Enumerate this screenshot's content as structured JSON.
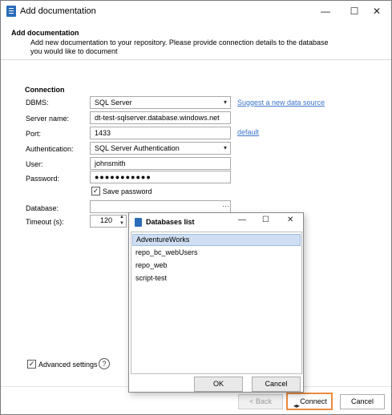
{
  "window": {
    "title": "Add documentation",
    "minimize": "—",
    "maximize": "☐",
    "close": "✕"
  },
  "header": {
    "title": "Add documentation",
    "description": "Add new documentation to your repository. Please provide connection details to the database you would like to document"
  },
  "connection": {
    "section_title": "Connection",
    "dbms_label": "DBMS:",
    "dbms_value": "SQL Server",
    "suggest_link": "Suggest a new data source",
    "server_label": "Server name:",
    "server_value": "dt-test-sqlserver.database.windows.net",
    "port_label": "Port:",
    "port_value": "1433",
    "default_link": "default",
    "auth_label": "Authentication:",
    "auth_value": "SQL Server Authentication",
    "user_label": "User:",
    "user_value": "johnsmith",
    "password_label": "Password:",
    "password_value": "●●●●●●●●●●●",
    "save_password_label": "Save password",
    "save_password_checked": true,
    "database_label": "Database:",
    "database_value": "",
    "database_browse": "···",
    "timeout_label": "Timeout (s):",
    "timeout_value": "120"
  },
  "advanced": {
    "label": "Advanced settings",
    "checked": true,
    "help": "?"
  },
  "footer": {
    "back_label": "< Back",
    "connect_label": "Connect",
    "cancel_label": "Cancel"
  },
  "databases_dialog": {
    "title": "Databases list",
    "minimize": "—",
    "maximize": "☐",
    "close": "✕",
    "items": [
      "AdventureWorks",
      "repo_bc_webUsers",
      "repo_web",
      "script-test"
    ],
    "selected_index": 0,
    "ok_label": "OK",
    "cancel_label": "Cancel"
  },
  "colors": {
    "accent": "#2b6cb8",
    "link": "#3b77c9",
    "connect_highlight": "#ea8a3e",
    "selection": "#cfdff3"
  },
  "icons": {
    "app": "documentation-icon",
    "connect": "connect-icon",
    "help": "help-icon"
  }
}
